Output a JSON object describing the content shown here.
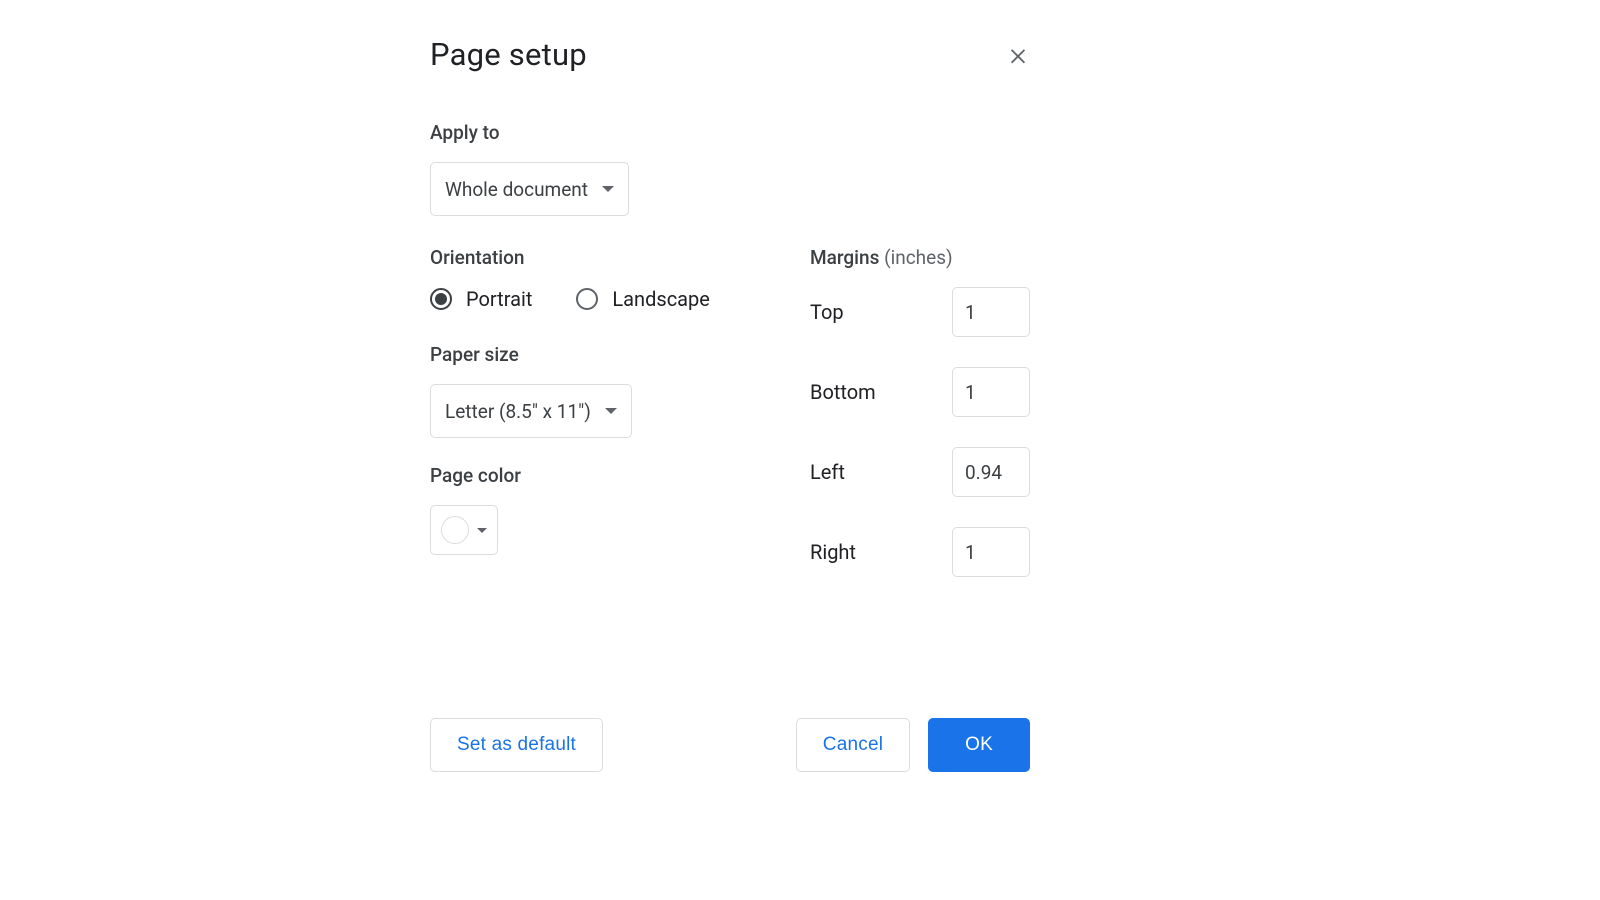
{
  "dialog": {
    "title": "Page setup",
    "apply_to": {
      "label": "Apply to",
      "selected": "Whole document"
    },
    "orientation": {
      "label": "Orientation",
      "options": {
        "portrait": "Portrait",
        "landscape": "Landscape"
      },
      "selected": "portrait"
    },
    "paper_size": {
      "label": "Paper size",
      "selected": "Letter (8.5\" x 11\")"
    },
    "page_color": {
      "label": "Page color",
      "selected_hex": "#ffffff"
    },
    "margins": {
      "label": "Margins",
      "unit_suffix": " (inches)",
      "top": {
        "label": "Top",
        "value": "1"
      },
      "bottom": {
        "label": "Bottom",
        "value": "1"
      },
      "left": {
        "label": "Left",
        "value": "0.94"
      },
      "right": {
        "label": "Right",
        "value": "1"
      }
    },
    "buttons": {
      "set_default": "Set as default",
      "cancel": "Cancel",
      "ok": "OK"
    }
  }
}
